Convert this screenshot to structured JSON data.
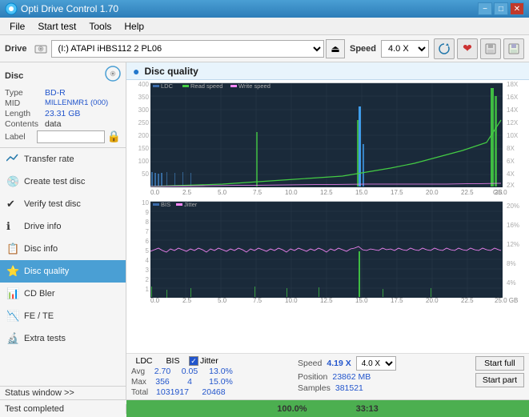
{
  "titlebar": {
    "title": "Opti Drive Control 1.70",
    "minimize": "−",
    "maximize": "□",
    "close": "✕"
  },
  "menu": {
    "items": [
      "File",
      "Start test",
      "Tools",
      "Help"
    ]
  },
  "drive": {
    "label": "Drive",
    "drive_value": "(I:)  ATAPI iHBS112  2 PL06",
    "eject_icon": "⏏",
    "speed_label": "Speed",
    "speed_value": "4.0 X"
  },
  "toolbar_icons": [
    "🔄",
    "❤",
    "💾",
    "💾"
  ],
  "disc_info": {
    "section_label": "Disc",
    "type_label": "Type",
    "type_value": "BD-R",
    "mid_label": "MID",
    "mid_value": "MILLENMR1 (000)",
    "length_label": "Length",
    "length_value": "23.31 GB",
    "contents_label": "Contents",
    "contents_value": "data",
    "label_label": "Label",
    "label_placeholder": ""
  },
  "nav": {
    "items": [
      {
        "id": "transfer-rate",
        "label": "Transfer rate",
        "icon": "📈"
      },
      {
        "id": "create-test-disc",
        "label": "Create test disc",
        "icon": "💿"
      },
      {
        "id": "verify-test-disc",
        "label": "Verify test disc",
        "icon": "✔"
      },
      {
        "id": "drive-info",
        "label": "Drive info",
        "icon": "ℹ"
      },
      {
        "id": "disc-info",
        "label": "Disc info",
        "icon": "📋"
      },
      {
        "id": "disc-quality",
        "label": "Disc quality",
        "icon": "⭐",
        "active": true
      },
      {
        "id": "cd-bler",
        "label": "CD Bler",
        "icon": "📊"
      },
      {
        "id": "fe-te",
        "label": "FE / TE",
        "icon": "📉"
      },
      {
        "id": "extra-tests",
        "label": "Extra tests",
        "icon": "🔬"
      }
    ]
  },
  "status_window": {
    "label": "Status window >>"
  },
  "disc_quality": {
    "title": "Disc quality",
    "legend": {
      "ldc": "LDC",
      "read_speed": "Read speed",
      "write_speed": "Write speed",
      "bis": "BIS",
      "jitter": "Jitter"
    },
    "top_chart": {
      "y_max": 400,
      "y_labels": [
        "400",
        "350",
        "300",
        "250",
        "200",
        "150",
        "100",
        "50"
      ],
      "x_labels": [
        "0.0",
        "2.5",
        "5.0",
        "7.5",
        "10.0",
        "12.5",
        "15.0",
        "17.5",
        "20.0",
        "22.5",
        "25.0"
      ],
      "y_right_labels": [
        "18X",
        "16X",
        "14X",
        "12X",
        "10X",
        "8X",
        "6X",
        "4X",
        "2X"
      ],
      "unit": "GB"
    },
    "bottom_chart": {
      "y_max": 10,
      "y_labels": [
        "10",
        "9",
        "8",
        "7",
        "6",
        "5",
        "4",
        "3",
        "2",
        "1"
      ],
      "x_labels": [
        "0.0",
        "2.5",
        "5.0",
        "7.5",
        "10.0",
        "12.5",
        "15.0",
        "17.5",
        "20.0",
        "22.5",
        "25.0"
      ],
      "y_right_labels": [
        "20%",
        "16%",
        "12%",
        "8%",
        "4%"
      ],
      "unit": "GB"
    }
  },
  "stats": {
    "ldc_label": "LDC",
    "bis_label": "BIS",
    "jitter_label": "Jitter",
    "speed_label": "Speed",
    "avg_label": "Avg",
    "max_label": "Max",
    "total_label": "Total",
    "avg_ldc": "2.70",
    "avg_bis": "0.05",
    "avg_jitter": "13.0%",
    "max_ldc": "356",
    "max_bis": "4",
    "max_jitter": "15.0%",
    "total_ldc": "1031917",
    "total_bis": "20468",
    "speed_value": "4.19 X",
    "speed_select": "4.0 X",
    "position_label": "Position",
    "position_value": "23862 MB",
    "samples_label": "Samples",
    "samples_value": "381521",
    "start_full_label": "Start full",
    "start_part_label": "Start part"
  },
  "bottom": {
    "status_label": "Test completed",
    "progress_percent": "100.0%",
    "progress_value": 100,
    "time": "33:13"
  }
}
